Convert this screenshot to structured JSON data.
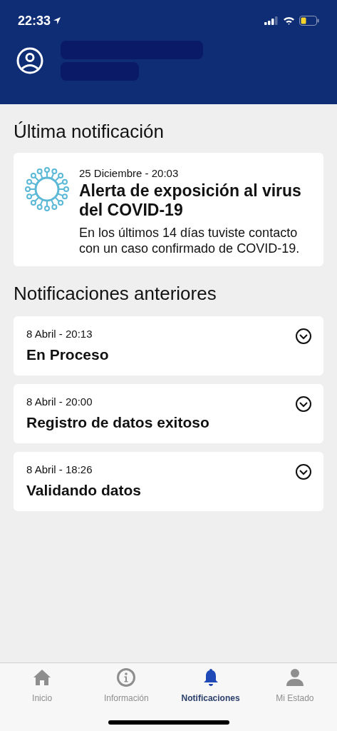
{
  "status_bar": {
    "time": "22:33"
  },
  "latest": {
    "heading": "Última notificación",
    "date": "25 Diciembre - 20:03",
    "title": "Alerta de exposición al virus del COVID-19",
    "body": "En los últimos 14 días tuviste contacto con un caso confirmado de COVID-19."
  },
  "previous": {
    "heading": "Notificaciones anteriores",
    "items": [
      {
        "date": "8 Abril - 20:13",
        "title": "En Proceso",
        "expanded": false
      },
      {
        "date": "8 Abril - 20:00",
        "title": "Registro de datos exitoso",
        "expanded": false
      },
      {
        "date": "8 Abril - 18:26",
        "title": "Validando datos",
        "expanded": false
      }
    ]
  },
  "tabs": [
    {
      "label": "Inicio",
      "selected": false
    },
    {
      "label": "Información",
      "selected": false
    },
    {
      "label": "Notificaciones",
      "selected": true
    },
    {
      "label": "Mi Estado",
      "selected": false
    }
  ]
}
